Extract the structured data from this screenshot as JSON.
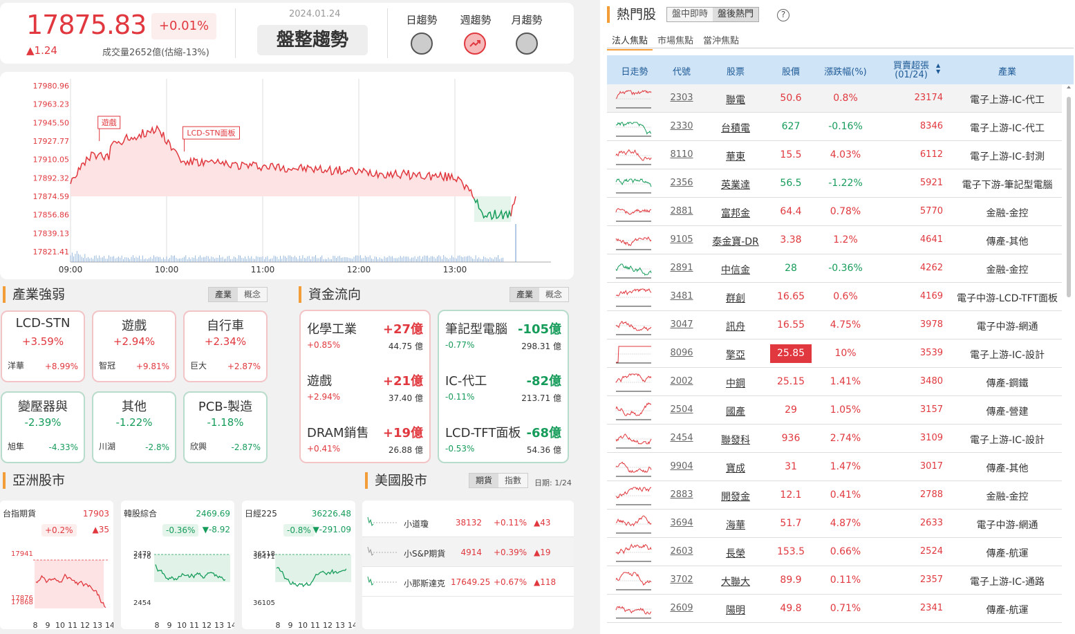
{
  "index": {
    "price": "17875.83",
    "pct": "+0.01%",
    "change": "▲1.24",
    "volume": "成交量2652億(估縮-13%)",
    "date": "2024.01.24",
    "status": "盤整趨勢"
  },
  "trends": [
    {
      "label": "日趨勢",
      "state": "neutral"
    },
    {
      "label": "週趨勢",
      "state": "up"
    },
    {
      "label": "月趨勢",
      "state": "neutral"
    }
  ],
  "intraday": {
    "y_ticks": [
      "17980.96",
      "17963.23",
      "17945.50",
      "17927.77",
      "17910.05",
      "17892.32",
      "17874.59",
      "17856.86",
      "17839.13",
      "17821.41"
    ],
    "x_ticks": [
      "09:00",
      "10:00",
      "11:00",
      "12:00",
      "13:00"
    ],
    "annotations": [
      "遊戲",
      "LCD-STN面板"
    ]
  },
  "industry": {
    "title": "產業強弱",
    "tabs": [
      "產業",
      "概念"
    ],
    "cards": [
      {
        "name": "LCD-STN",
        "pct": "+3.59%",
        "stock": "洋華",
        "spct": "+8.99%",
        "dir": "r"
      },
      {
        "name": "遊戲",
        "pct": "+2.94%",
        "stock": "智冠",
        "spct": "+9.81%",
        "dir": "r"
      },
      {
        "name": "自行車",
        "pct": "+2.34%",
        "stock": "巨大",
        "spct": "+2.87%",
        "dir": "r"
      },
      {
        "name": "變壓器與",
        "pct": "-2.39%",
        "stock": "旭隼",
        "spct": "-4.33%",
        "dir": "g"
      },
      {
        "name": "其他",
        "pct": "-1.22%",
        "stock": "川湖",
        "spct": "-2.8%",
        "dir": "g"
      },
      {
        "name": "PCB-製造",
        "pct": "-1.18%",
        "stock": "欣興",
        "spct": "-2.87%",
        "dir": "g"
      }
    ]
  },
  "flow": {
    "title": "資金流向",
    "tabs": [
      "產業",
      "概念"
    ],
    "in": [
      {
        "name": "化學工業",
        "amt": "+27億",
        "pct": "+0.85%",
        "total": "44.75 億"
      },
      {
        "name": "遊戲",
        "amt": "+21億",
        "pct": "+2.94%",
        "total": "37.40 億"
      },
      {
        "name": "DRAM銷售",
        "amt": "+19億",
        "pct": "+0.41%",
        "total": "26.88 億"
      }
    ],
    "out": [
      {
        "name": "筆記型電腦",
        "amt": "-105億",
        "pct": "-0.77%",
        "total": "298.31 億"
      },
      {
        "name": "IC-代工",
        "amt": "-82億",
        "pct": "-0.11%",
        "total": "213.71 億"
      },
      {
        "name": "LCD-TFT面板",
        "amt": "-68億",
        "pct": "-0.53%",
        "total": "54.36 億"
      }
    ]
  },
  "asia": {
    "title": "亞洲股市",
    "cards": [
      {
        "name": "台指期貨",
        "val": "17903",
        "pct": "+0.2%",
        "chg": "▲35",
        "dir": "r",
        "ytop": "17941",
        "ybot1": "17876",
        "ybot2": "17868",
        "x": [
          "8",
          "9",
          "10",
          "11",
          "12",
          "13",
          "14"
        ]
      },
      {
        "name": "韓股綜合",
        "val": "2469.69",
        "pct": "-0.36%",
        "chg": "▼-8.92",
        "dir": "g",
        "ytop": "2479",
        "ytop2": "2476",
        "ybot1": "2454",
        "x": [
          "8",
          "9",
          "10",
          "11",
          "12",
          "13",
          "14"
        ]
      },
      {
        "name": "日經225",
        "val": "36226.48",
        "pct": "-0.8%",
        "chg": "▼-291.09",
        "dir": "g",
        "ytop": "36518",
        "ytop2": "36471",
        "ybot1": "36105",
        "x": [
          "8",
          "9",
          "10",
          "11",
          "12",
          "13",
          "14"
        ]
      }
    ]
  },
  "us": {
    "title": "美國股市",
    "tabs": [
      "期貨",
      "指數"
    ],
    "date": "日期: 1/24",
    "rows": [
      {
        "name": "小道瓊",
        "val": "38132",
        "pct": "+0.11%",
        "chg": "▲43"
      },
      {
        "name": "小S&P期貨",
        "val": "4914",
        "pct": "+0.39%",
        "chg": "▲19"
      },
      {
        "name": "小那斯達克",
        "val": "17649.25",
        "pct": "+0.67%",
        "chg": "▲118"
      }
    ]
  },
  "hot": {
    "title": "熱門股",
    "tabs": [
      "盤中即時",
      "盤後熱門"
    ],
    "help": "?",
    "subtabs": [
      "法人焦點",
      "市場焦點",
      "當沖焦點"
    ],
    "columns": [
      "日走勢",
      "代號",
      "股票",
      "股價",
      "漲跌幅(%)",
      "買賣超張",
      "(01/24)",
      "產業"
    ],
    "rows": [
      {
        "code": "2303",
        "name": "聯電",
        "price": "50.6",
        "pct": "0.8%",
        "vol": "23174",
        "ind": "電子上游-IC-代工",
        "dir": "r"
      },
      {
        "code": "2330",
        "name": "台積電",
        "price": "627",
        "pct": "-0.16%",
        "vol": "8346",
        "ind": "電子上游-IC-代工",
        "dir": "g"
      },
      {
        "code": "8110",
        "name": "華東",
        "price": "15.5",
        "pct": "4.03%",
        "vol": "6112",
        "ind": "電子上游-IC-封測",
        "dir": "r"
      },
      {
        "code": "2356",
        "name": "英業達",
        "price": "56.5",
        "pct": "-1.22%",
        "vol": "5921",
        "ind": "電子下游-筆記型電腦",
        "dir": "g"
      },
      {
        "code": "2881",
        "name": "富邦金",
        "price": "64.4",
        "pct": "0.78%",
        "vol": "5770",
        "ind": "金融-金控",
        "dir": "r"
      },
      {
        "code": "9105",
        "name": "泰金寶-DR",
        "price": "3.38",
        "pct": "1.2%",
        "vol": "4641",
        "ind": "傳產-其他",
        "dir": "r"
      },
      {
        "code": "2891",
        "name": "中信金",
        "price": "28",
        "pct": "-0.36%",
        "vol": "4262",
        "ind": "金融-金控",
        "dir": "g"
      },
      {
        "code": "3481",
        "name": "群創",
        "price": "16.65",
        "pct": "0.6%",
        "vol": "4169",
        "ind": "電子中游-LCD-TFT面板",
        "dir": "r"
      },
      {
        "code": "3047",
        "name": "訊舟",
        "price": "16.55",
        "pct": "4.75%",
        "vol": "3978",
        "ind": "電子中游-網通",
        "dir": "r"
      },
      {
        "code": "8096",
        "name": "擎亞",
        "price": "25.85",
        "pct": "10%",
        "vol": "3539",
        "ind": "電子上游-IC-設計",
        "dir": "r",
        "limit": true
      },
      {
        "code": "2002",
        "name": "中鋼",
        "price": "25.15",
        "pct": "1.41%",
        "vol": "3480",
        "ind": "傳產-鋼鐵",
        "dir": "r"
      },
      {
        "code": "2504",
        "name": "國產",
        "price": "29",
        "pct": "1.05%",
        "vol": "3157",
        "ind": "傳產-營建",
        "dir": "r"
      },
      {
        "code": "2454",
        "name": "聯發科",
        "price": "936",
        "pct": "2.74%",
        "vol": "3109",
        "ind": "電子上游-IC-設計",
        "dir": "r"
      },
      {
        "code": "9904",
        "name": "寶成",
        "price": "31",
        "pct": "1.47%",
        "vol": "3017",
        "ind": "傳產-其他",
        "dir": "r"
      },
      {
        "code": "2883",
        "name": "開發金",
        "price": "12.1",
        "pct": "0.41%",
        "vol": "2788",
        "ind": "金融-金控",
        "dir": "r"
      },
      {
        "code": "3694",
        "name": "海華",
        "price": "51.7",
        "pct": "4.87%",
        "vol": "2633",
        "ind": "電子中游-網通",
        "dir": "r"
      },
      {
        "code": "2603",
        "name": "長榮",
        "price": "153.5",
        "pct": "0.66%",
        "vol": "2524",
        "ind": "傳產-航運",
        "dir": "r"
      },
      {
        "code": "3702",
        "name": "大聯大",
        "price": "89.9",
        "pct": "0.11%",
        "vol": "2357",
        "ind": "電子上游-IC-通路",
        "dir": "r"
      },
      {
        "code": "2609",
        "name": "陽明",
        "price": "49.8",
        "pct": "0.71%",
        "vol": "2341",
        "ind": "傳產-航運",
        "dir": "r"
      }
    ]
  },
  "colors": {
    "up": "#e0383e",
    "down": "#169c5a",
    "accent": "#f29d38",
    "header_bg": "#cfe4f7"
  }
}
